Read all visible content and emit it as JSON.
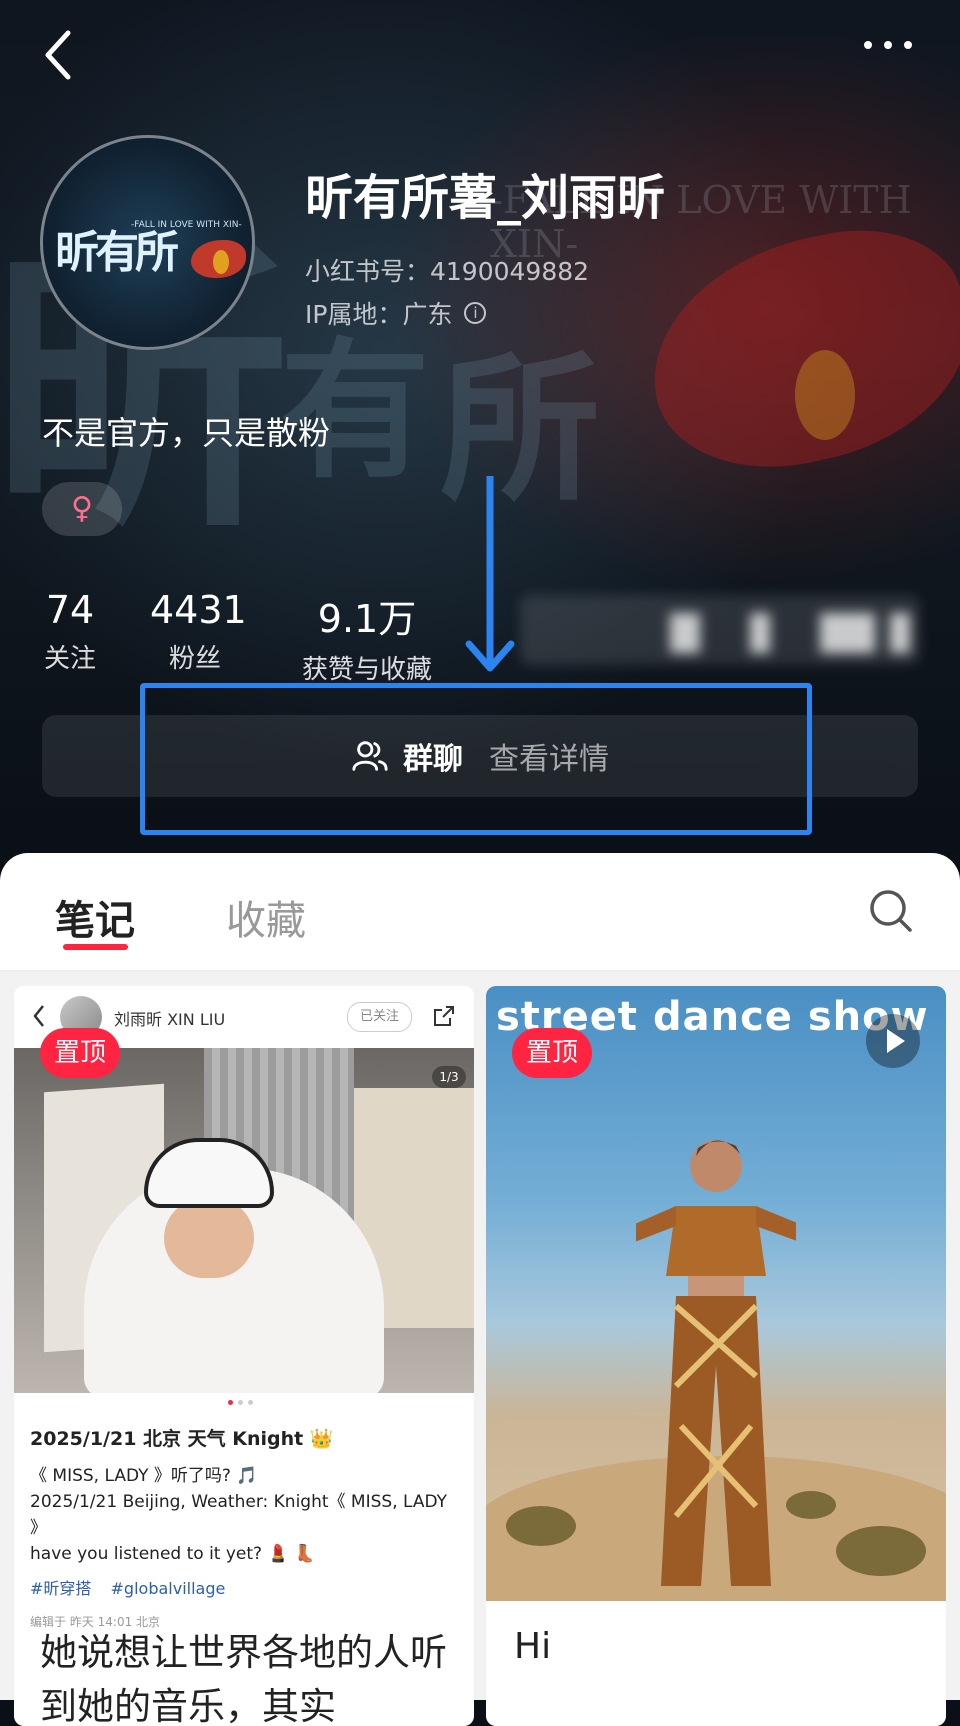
{
  "profile": {
    "username": "昕有所薯_刘雨昕",
    "red_id": "小红书号：4190049882",
    "ip_location": "IP属地：广东",
    "bio": "不是官方，只是散粉",
    "gender_symbol": "♀",
    "avatar_text": "昕有所",
    "avatar_sub": "-FALL IN LOVE WITH XIN-"
  },
  "background": {
    "tagline": "-FALL IN LOVE WITH XIN-",
    "logo_chars": [
      "昕",
      "有",
      "所"
    ]
  },
  "stats": [
    {
      "value": "74",
      "label": "关注"
    },
    {
      "value": "4431",
      "label": "粉丝"
    },
    {
      "value": "9.1万",
      "label": "获赞与收藏"
    }
  ],
  "group_chat": {
    "label": "群聊",
    "detail": "查看详情",
    "icon": "group-icon"
  },
  "annotation": {
    "highlight_color": "#2c84f0"
  },
  "tabs": [
    {
      "label": "笔记",
      "active": true
    },
    {
      "label": "收藏",
      "active": false
    }
  ],
  "accent_color": "#ff2442",
  "notes": [
    {
      "badge": "置顶",
      "header_name": "刘雨昕 XIN LIU",
      "header_follow": "已关注",
      "image_counter": "1/3",
      "line1": "2025/1/21 北京 天气 Knight 👑",
      "line2": "《 MISS, LADY 》听了吗? 🎵",
      "line3": "2025/1/21 Beijing, Weather: Knight《 MISS, LADY 》",
      "line4": "have you listened to it yet? 💄 👢",
      "tags": [
        "#昕穿搭",
        "#globalvillage"
      ],
      "edited": "编辑于 昨天 14:01 北京",
      "title": "她说想让世界各地的人听到她的音乐，其实"
    },
    {
      "badge": "置顶",
      "image_title": "street dance show",
      "title": "Hi"
    }
  ]
}
